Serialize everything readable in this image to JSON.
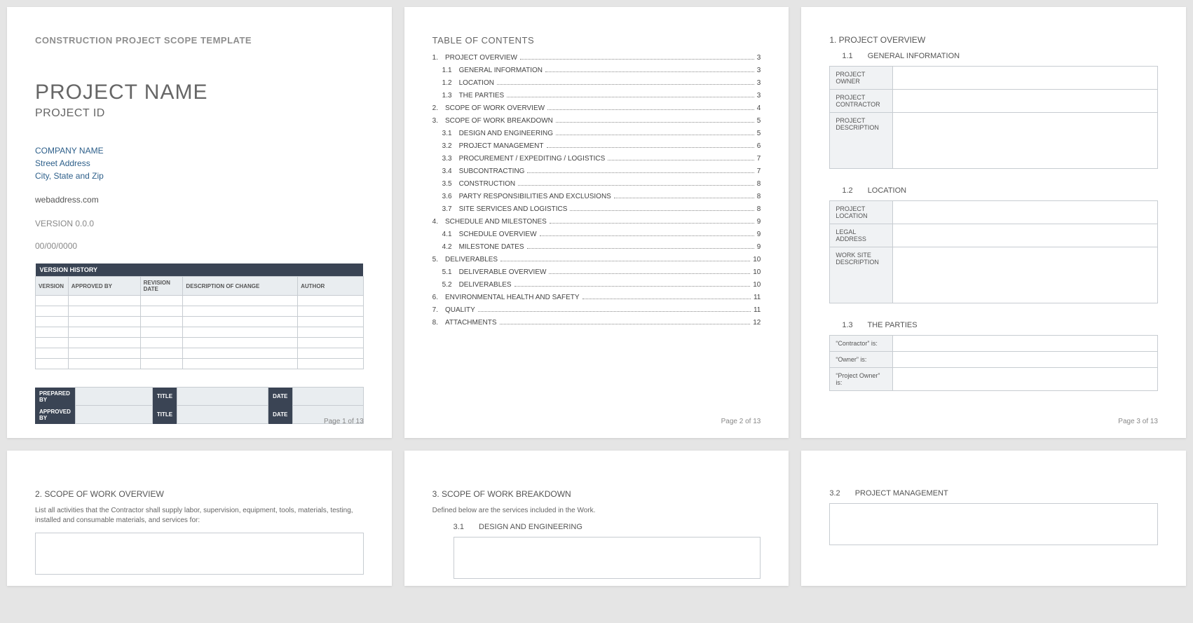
{
  "total_pages": 13,
  "page1": {
    "template_title": "CONSTRUCTION PROJECT SCOPE TEMPLATE",
    "project_name": "PROJECT NAME",
    "project_id": "PROJECT ID",
    "company_name": "COMPANY NAME",
    "street_address": "Street Address",
    "city_state_zip": "City, State and Zip",
    "web_address": "webaddress.com",
    "version": "VERSION 0.0.0",
    "date": "00/00/0000",
    "version_history_header": "VERSION HISTORY",
    "columns": {
      "version": "VERSION",
      "approved_by": "APPROVED BY",
      "revision_date": "REVISION DATE",
      "description_of_change": "DESCRIPTION OF CHANGE",
      "author": "AUTHOR"
    },
    "sign": {
      "prepared_by": "PREPARED BY",
      "approved_by": "APPROVED BY",
      "title": "TITLE",
      "date": "DATE"
    },
    "page_footer": "Page 1 of 13"
  },
  "page2": {
    "title": "TABLE OF CONTENTS",
    "entries": [
      {
        "num": "1.",
        "label": "PROJECT OVERVIEW",
        "page": "3",
        "sub": false
      },
      {
        "num": "1.1",
        "label": "GENERAL INFORMATION",
        "page": "3",
        "sub": true
      },
      {
        "num": "1.2",
        "label": "LOCATION",
        "page": "3",
        "sub": true
      },
      {
        "num": "1.3",
        "label": "THE PARTIES",
        "page": "3",
        "sub": true
      },
      {
        "num": "2.",
        "label": "SCOPE OF WORK OVERVIEW",
        "page": "4",
        "sub": false
      },
      {
        "num": "3.",
        "label": "SCOPE OF WORK BREAKDOWN",
        "page": "5",
        "sub": false
      },
      {
        "num": "3.1",
        "label": "DESIGN AND ENGINEERING",
        "page": "5",
        "sub": true
      },
      {
        "num": "3.2",
        "label": "PROJECT MANAGEMENT",
        "page": "6",
        "sub": true
      },
      {
        "num": "3.3",
        "label": "PROCUREMENT / EXPEDITING / LOGISTICS",
        "page": "7",
        "sub": true
      },
      {
        "num": "3.4",
        "label": "SUBCONTRACTING",
        "page": "7",
        "sub": true
      },
      {
        "num": "3.5",
        "label": "CONSTRUCTION",
        "page": "8",
        "sub": true
      },
      {
        "num": "3.6",
        "label": "PARTY RESPONSIBILITIES AND EXCLUSIONS",
        "page": "8",
        "sub": true
      },
      {
        "num": "3.7",
        "label": "SITE SERVICES AND LOGISTICS",
        "page": "8",
        "sub": true
      },
      {
        "num": "4.",
        "label": "SCHEDULE AND MILESTONES",
        "page": "9",
        "sub": false
      },
      {
        "num": "4.1",
        "label": "SCHEDULE OVERVIEW",
        "page": "9",
        "sub": true
      },
      {
        "num": "4.2",
        "label": "MILESTONE DATES",
        "page": "9",
        "sub": true
      },
      {
        "num": "5.",
        "label": "DELIVERABLES",
        "page": "10",
        "sub": false
      },
      {
        "num": "5.1",
        "label": "DELIVERABLE OVERVIEW",
        "page": "10",
        "sub": true
      },
      {
        "num": "5.2",
        "label": "DELIVERABLES",
        "page": "10",
        "sub": true
      },
      {
        "num": "6.",
        "label": "ENVIRONMENTAL HEALTH AND SAFETY",
        "page": "11",
        "sub": false
      },
      {
        "num": "7.",
        "label": "QUALITY",
        "page": "11",
        "sub": false
      },
      {
        "num": "8.",
        "label": "ATTACHMENTS",
        "page": "12",
        "sub": false
      }
    ],
    "page_footer": "Page 2 of 13"
  },
  "page3": {
    "sec1": "1.  PROJECT OVERVIEW",
    "sub11_num": "1.1",
    "sub11_label": "GENERAL INFORMATION",
    "t1": {
      "project_owner": "PROJECT OWNER",
      "project_contractor": "PROJECT CONTRACTOR",
      "project_description": "PROJECT DESCRIPTION"
    },
    "sub12_num": "1.2",
    "sub12_label": "LOCATION",
    "t2": {
      "project_location": "PROJECT LOCATION",
      "legal_address": "LEGAL ADDRESS",
      "work_site_description": "WORK SITE DESCRIPTION"
    },
    "sub13_num": "1.3",
    "sub13_label": "THE PARTIES",
    "t3": {
      "contractor": "“Contractor” is:",
      "owner": "“Owner” is:",
      "project_owner": "“Project Owner” is:"
    },
    "page_footer": "Page 3 of 13"
  },
  "page4": {
    "title": "2.  SCOPE OF WORK OVERVIEW",
    "note": "List all activities that the Contractor shall supply labor, supervision, equipment, tools, materials, testing, installed and consumable materials, and services for:"
  },
  "page5": {
    "title": "3.  SCOPE OF WORK BREAKDOWN",
    "note": "Defined below are the services included in the Work.",
    "sub_num": "3.1",
    "sub_label": "DESIGN AND ENGINEERING"
  },
  "page6": {
    "sub_num": "3.2",
    "sub_label": "PROJECT MANAGEMENT"
  }
}
